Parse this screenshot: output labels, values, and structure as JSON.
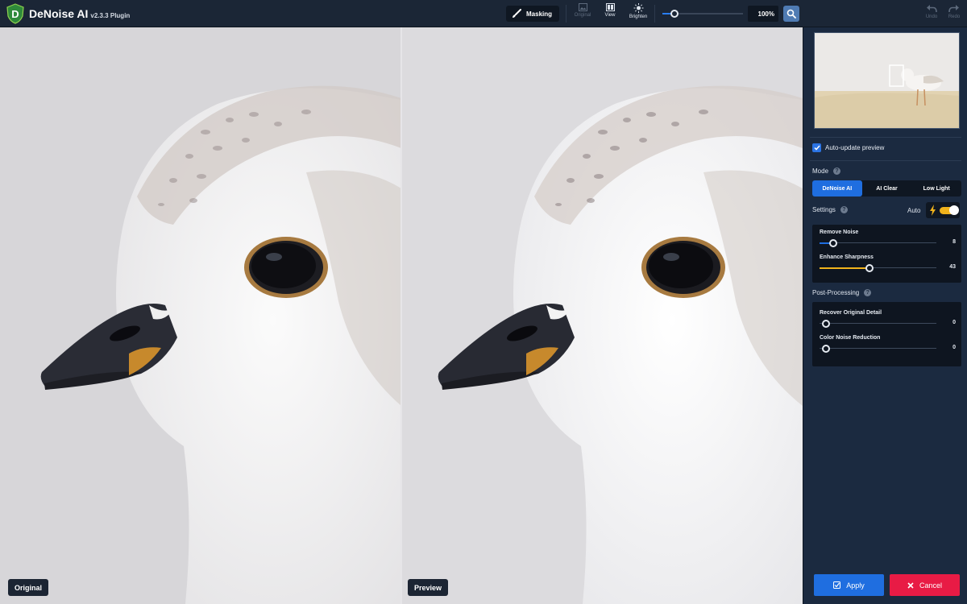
{
  "app": {
    "title": "DeNoise AI",
    "version": "v2.3.3 Plugin",
    "logo_letter": "D"
  },
  "toolbar": {
    "masking_label": "Masking",
    "tools": [
      {
        "label": "Original",
        "icon": "image-icon",
        "enabled": false
      },
      {
        "label": "View",
        "icon": "split-view-icon",
        "enabled": true
      },
      {
        "label": "Brighten",
        "icon": "sun-icon",
        "enabled": true
      }
    ],
    "zoom_level": "100%",
    "zoom_slider_fraction": 0.12,
    "undo_label": "Undo",
    "redo_label": "Redo"
  },
  "canvas": {
    "left_label": "Original",
    "right_label": "Preview"
  },
  "panel": {
    "auto_update": {
      "label": "Auto-update preview",
      "checked": true
    },
    "mode": {
      "label": "Mode",
      "options": [
        "DeNoise AI",
        "AI Clear",
        "Low Light"
      ],
      "selected": "DeNoise AI"
    },
    "settings": {
      "label": "Settings",
      "auto_label": "Auto",
      "auto_on": true,
      "sliders": [
        {
          "name": "Remove Noise",
          "value": "8",
          "fraction": 0.12
        },
        {
          "name": "Enhance Sharpness",
          "value": "43",
          "fraction": 0.43
        }
      ]
    },
    "post_processing": {
      "label": "Post-Processing",
      "sliders": [
        {
          "name": "Recover Original Detail",
          "value": "0",
          "fraction": 0.0
        },
        {
          "name": "Color Noise Reduction",
          "value": "0",
          "fraction": 0.0
        }
      ]
    },
    "apply_label": "Apply",
    "cancel_label": "Cancel"
  },
  "colors": {
    "accent_blue": "#1f6ee0",
    "auto_yellow": "#f0b31c",
    "cancel_red": "#e81b45",
    "panel_bg": "#1b2a40"
  }
}
